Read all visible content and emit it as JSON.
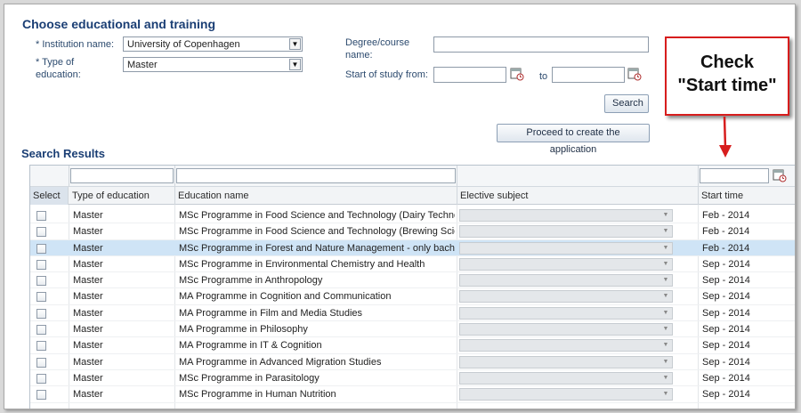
{
  "form": {
    "title": "Choose educational and training",
    "institution_label": "* Institution name:",
    "institution_value": "University of Copenhagen",
    "type_label_line1": "* Type of",
    "type_label_line2": "education:",
    "type_value": "Master",
    "degree_label_line1": "Degree/course",
    "degree_label_line2": "name:",
    "degree_value": "",
    "start_label": "Start of study from:",
    "start_from_value": "",
    "to_label": "to",
    "start_to_value": "",
    "search_button": "Search",
    "proceed_button": "Proceed to create the application"
  },
  "results": {
    "title": "Search Results",
    "columns": [
      "Select",
      "Type of education",
      "Education name",
      "Elective subject",
      "Start time"
    ],
    "rows": [
      {
        "type": "Master",
        "name": "MSc Programme in Food Science and Technology (Dairy Technology)",
        "start": "Feb - 2014"
      },
      {
        "type": "Master",
        "name": "MSc Programme in Food Science and Technology (Brewing Science and Technology)",
        "start": "Feb - 2014"
      },
      {
        "type": "Master",
        "name": "MSc Programme in Forest and Nature Management - only bachelors",
        "start": "Feb - 2014",
        "highlighted": true
      },
      {
        "type": "Master",
        "name": "MSc Programme in Environmental Chemistry and Health",
        "start": "Sep - 2014"
      },
      {
        "type": "Master",
        "name": "MSc Programme in Anthropology",
        "start": "Sep - 2014"
      },
      {
        "type": "Master",
        "name": "MA Programme in Cognition and Communication",
        "start": "Sep - 2014"
      },
      {
        "type": "Master",
        "name": "MA Programme in Film and Media Studies",
        "start": "Sep - 2014"
      },
      {
        "type": "Master",
        "name": "MA Programme in Philosophy",
        "start": "Sep - 2014"
      },
      {
        "type": "Master",
        "name": "MA Programme in IT & Cognition",
        "start": "Sep - 2014"
      },
      {
        "type": "Master",
        "name": "MA Programme in Advanced Migration Studies",
        "start": "Sep - 2014"
      },
      {
        "type": "Master",
        "name": "MSc Programme in Parasitology",
        "start": "Sep - 2014"
      },
      {
        "type": "Master",
        "name": "MSc Programme in Human Nutrition",
        "start": "Sep - 2014"
      }
    ]
  },
  "callout": {
    "line1": "Check",
    "line2": "\"Start time\"",
    "border_color": "#d71d1d"
  }
}
